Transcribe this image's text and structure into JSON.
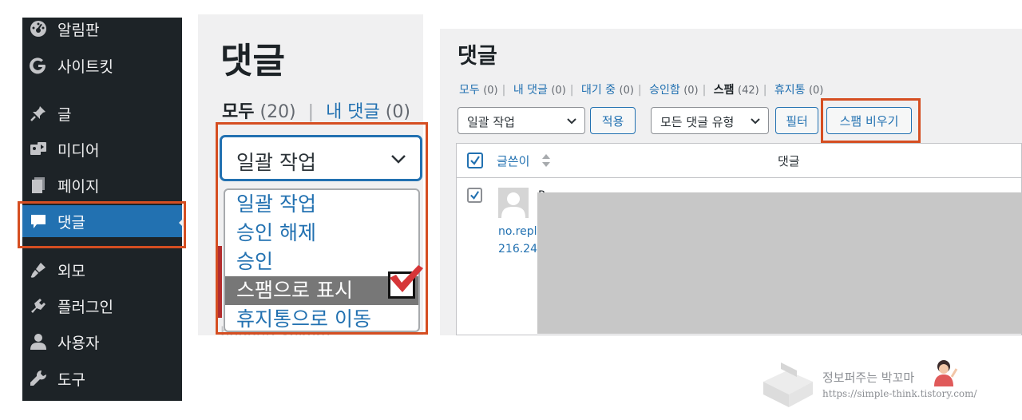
{
  "sidebar": {
    "items": [
      {
        "label": "알림판",
        "icon": "dashboard-icon"
      },
      {
        "label": "사이트킷",
        "icon": "google-g-icon"
      },
      {
        "label": "글",
        "icon": "pushpin-icon"
      },
      {
        "label": "미디어",
        "icon": "media-icon"
      },
      {
        "label": "페이지",
        "icon": "page-icon"
      },
      {
        "label": "댓글",
        "icon": "comment-icon",
        "active": true
      },
      {
        "label": "외모",
        "icon": "paintbrush-icon"
      },
      {
        "label": "플러그인",
        "icon": "plugin-icon"
      },
      {
        "label": "사용자",
        "icon": "user-icon"
      },
      {
        "label": "도구",
        "icon": "wrench-icon"
      }
    ]
  },
  "left_panel": {
    "title": "댓글",
    "filter": {
      "current_label": "모두",
      "current_count": "(20)",
      "link_label": "내 댓글",
      "link_count": "(0)"
    },
    "bulk_select": "일괄 작업",
    "options": [
      "일괄 작업",
      "승인 해제",
      "승인",
      "스팸으로 표시",
      "휴지통으로 이동"
    ],
    "selected_option": "스팸으로 표시"
  },
  "right_panel": {
    "title": "댓글",
    "filters": [
      {
        "label": "모두",
        "count": "(0)"
      },
      {
        "label": "내 댓글",
        "count": "(0)"
      },
      {
        "label": "대기 중",
        "count": "(0)"
      },
      {
        "label": "승인함",
        "count": "(0)"
      },
      {
        "label": "스팸",
        "count": "(42)",
        "current": true
      },
      {
        "label": "휴지통",
        "count": "(0)"
      }
    ],
    "bulk_select": "일괄 작업",
    "apply_button": "적용",
    "type_select": "모든 댓글 유형",
    "filter_button": "필터",
    "empty_spam_button": "스팸 비우기",
    "table": {
      "col_author": "글쓴이",
      "col_comment": "댓글",
      "row_author_peek": "P",
      "row_email_peek": "no.reply",
      "row_ip_peek": "216.24."
    }
  },
  "watermark": {
    "name": "정보퍼주는 박꼬마",
    "url": "https://simple-think.tistory.com/"
  },
  "colors": {
    "sidebar_bg": "#1d2327",
    "accent": "#2271b1",
    "highlight": "#d54e21",
    "check_red": "#d63638"
  }
}
